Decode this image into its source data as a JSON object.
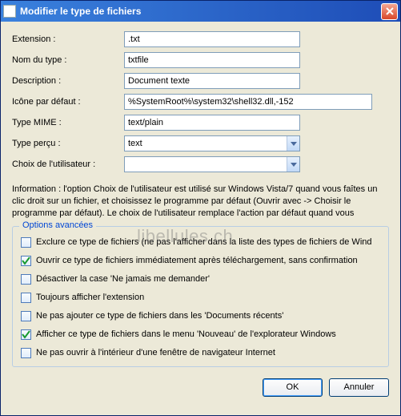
{
  "window": {
    "title": "Modifier le type de fichiers"
  },
  "form": {
    "extension_label": "Extension :",
    "extension_value": ".txt",
    "name_label": "Nom du type :",
    "name_value": "txtfile",
    "description_label": "Description :",
    "description_value": "Document texte",
    "icon_label": "Icône par défaut :",
    "icon_value": "%SystemRoot%\\system32\\shell32.dll,-152",
    "mime_label": "Type MIME :",
    "mime_value": "text/plain",
    "perceived_label": "Type perçu :",
    "perceived_value": "text",
    "userchoice_label": "Choix de l'utilisateur :",
    "userchoice_value": ""
  },
  "info_text": "Information : l'option Choix de l'utilisateur est utilisé sur Windows Vista/7 quand vous faîtes un clic droit sur un fichier, et choisissez le programme par défaut (Ouvrir avec -> Choisir le programme par défaut). Le choix de l'utilisateur remplace l'action par défaut quand vous",
  "advanced": {
    "title": "Options avancées",
    "items": [
      {
        "checked": false,
        "label": "Exclure ce type de fichiers (ne pas l'afficher dans la liste des types de fichiers de Wind"
      },
      {
        "checked": true,
        "label": "Ouvrir ce type de fichiers immédiatement après téléchargement, sans confirmation"
      },
      {
        "checked": false,
        "label": "Désactiver la case 'Ne jamais me demander'"
      },
      {
        "checked": false,
        "label": "Toujours afficher l'extension"
      },
      {
        "checked": false,
        "label": "Ne pas ajouter ce type de fichiers dans les 'Documents récents'"
      },
      {
        "checked": true,
        "label": "Afficher ce type de fichiers dans le menu 'Nouveau' de l'explorateur Windows"
      },
      {
        "checked": false,
        "label": "Ne pas ouvrir à l'intérieur d'une fenêtre de navigateur Internet"
      }
    ]
  },
  "buttons": {
    "ok": "OK",
    "cancel": "Annuler"
  },
  "watermark": "libellules.ch"
}
